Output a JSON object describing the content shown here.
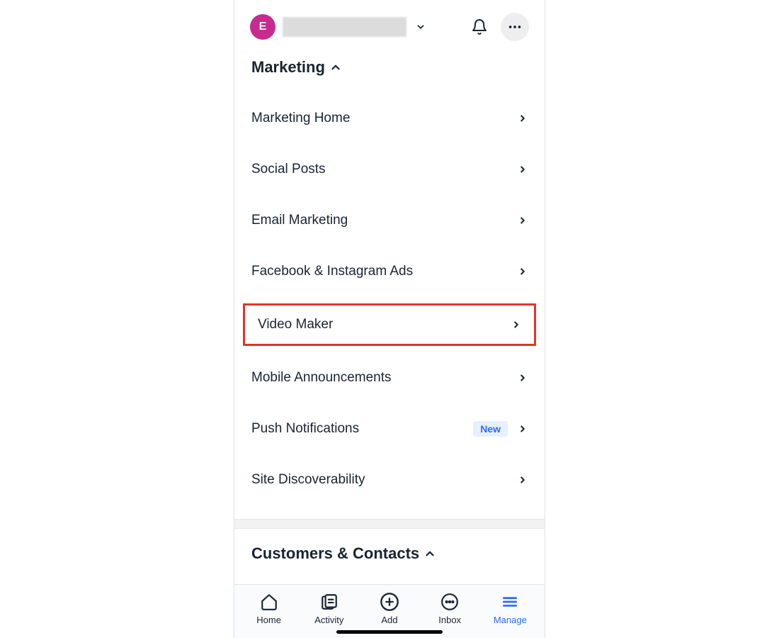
{
  "header": {
    "avatar_initial": "E"
  },
  "sections": {
    "marketing": {
      "title": "Marketing",
      "items": [
        {
          "label": "Marketing Home"
        },
        {
          "label": "Social Posts"
        },
        {
          "label": "Email Marketing"
        },
        {
          "label": "Facebook & Instagram Ads"
        },
        {
          "label": "Video Maker",
          "highlighted": true
        },
        {
          "label": "Mobile Announcements"
        },
        {
          "label": "Push Notifications",
          "badge": "New"
        },
        {
          "label": "Site Discoverability"
        }
      ]
    },
    "customers": {
      "title": "Customers & Contacts"
    }
  },
  "badges": {
    "new": "New"
  },
  "bottom_nav": {
    "home": "Home",
    "activity": "Activity",
    "add": "Add",
    "inbox": "Inbox",
    "manage": "Manage",
    "active": "manage"
  }
}
